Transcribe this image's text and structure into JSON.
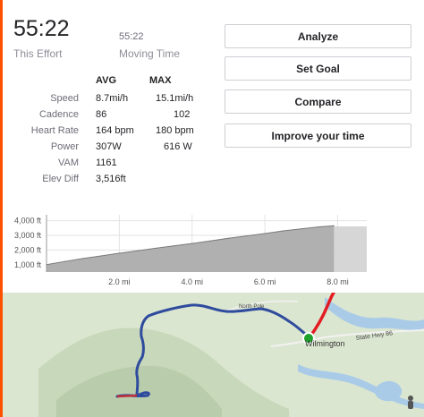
{
  "effort": {
    "elapsed_time": "55:22",
    "elapsed_label": "This Effort",
    "moving_time": "55:22",
    "moving_label": "Moving Time"
  },
  "stats": {
    "headers": {
      "avg": "AVG",
      "max": "MAX"
    },
    "rows": [
      {
        "label": "Speed",
        "avg": "8.7mi/h",
        "max": "15.1mi/h"
      },
      {
        "label": "Cadence",
        "avg": "86",
        "max": "102"
      },
      {
        "label": "Heart Rate",
        "avg": "164 bpm",
        "max": "180 bpm"
      },
      {
        "label": "Power",
        "avg": "307W",
        "max": "616 W"
      },
      {
        "label": "VAM",
        "avg": "1161",
        "max": ""
      },
      {
        "label": "Elev Diff",
        "avg": "3,516ft",
        "max": ""
      }
    ]
  },
  "actions": {
    "analyze": "Analyze",
    "set_goal": "Set Goal",
    "compare": "Compare",
    "improve": "Improve your time"
  },
  "chart_data": {
    "type": "area",
    "x": [
      0,
      0.5,
      1,
      1.5,
      2,
      2.5,
      3,
      3.5,
      4,
      4.5,
      5,
      5.5,
      6,
      6.5,
      7,
      7.5,
      7.9
    ],
    "y": [
      1000,
      1220,
      1420,
      1600,
      1780,
      1950,
      2120,
      2280,
      2440,
      2620,
      2800,
      2960,
      3120,
      3300,
      3440,
      3580,
      3650
    ],
    "xlabel": "",
    "ylabel": "",
    "x_ticks": [
      "2.0 mi",
      "4.0 mi",
      "6.0 mi",
      "8.0 mi"
    ],
    "y_ticks": [
      "1,000 ft",
      "2,000 ft",
      "3,000 ft",
      "4,000 ft"
    ],
    "x_tick_values": [
      2,
      4,
      6,
      8
    ],
    "y_tick_values": [
      1000,
      2000,
      3000,
      4000
    ],
    "xlim": [
      0,
      8.8
    ],
    "ylim": [
      500,
      4400
    ],
    "grid": true,
    "highlight_range": [
      7.9,
      8.8
    ],
    "colors": {
      "fill": "#b0b0b0",
      "line": "#7a7a7a",
      "highlight": "#d6d6d6"
    }
  },
  "map": {
    "labels": {
      "road_north": "North Pole",
      "highway": "State Hwy 86",
      "town": "Wilmington"
    },
    "colors": {
      "route": "#2e4b9e",
      "segment": "#e31b23",
      "start_marker": "#1fa02a",
      "land": "#dbe6d0",
      "water": "#a9cbe8"
    }
  }
}
